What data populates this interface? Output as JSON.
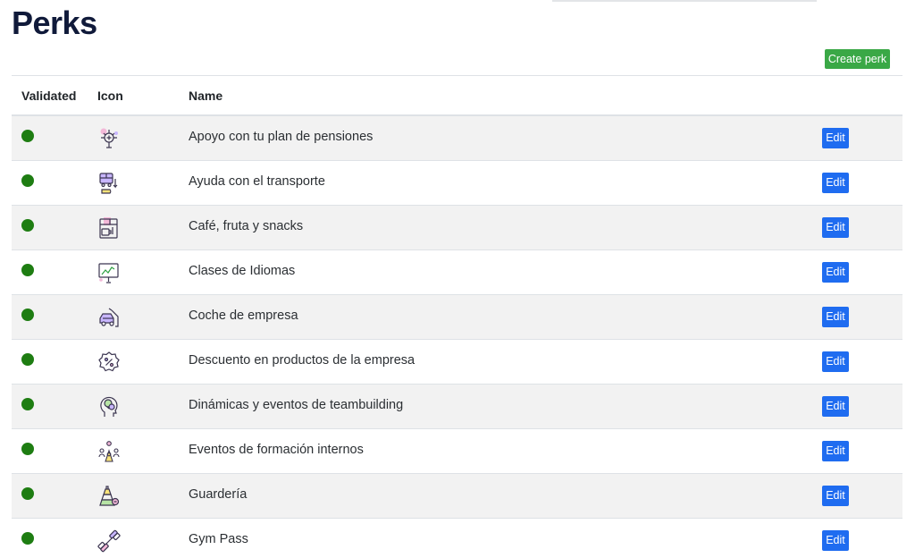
{
  "page": {
    "title": "Perks",
    "create_label": "Create perk"
  },
  "table": {
    "headers": {
      "validated": "Validated",
      "icon": "Icon",
      "name": "Name"
    },
    "rows": [
      {
        "name": "Apoyo con tu plan de pensiones",
        "icon": "pension-chart-icon",
        "validated": true,
        "edit_label": "Edit"
      },
      {
        "name": "Ayuda con el transporte",
        "icon": "transport-bus-icon",
        "validated": true,
        "edit_label": "Edit"
      },
      {
        "name": "Café, fruta y snacks",
        "icon": "coffee-machine-icon",
        "validated": true,
        "edit_label": "Edit"
      },
      {
        "name": "Clases de Idiomas",
        "icon": "presentation-board-icon",
        "validated": true,
        "edit_label": "Edit"
      },
      {
        "name": "Coche de empresa",
        "icon": "company-car-icon",
        "validated": true,
        "edit_label": "Edit"
      },
      {
        "name": "Descuento en productos de la empresa",
        "icon": "discount-badge-icon",
        "validated": true,
        "edit_label": "Edit"
      },
      {
        "name": "Dinámicas y eventos de teambuilding",
        "icon": "teambuilding-head-icon",
        "validated": true,
        "edit_label": "Edit"
      },
      {
        "name": "Eventos de formación internos",
        "icon": "training-group-icon",
        "validated": true,
        "edit_label": "Edit"
      },
      {
        "name": "Guardería",
        "icon": "toy-stacker-icon",
        "validated": true,
        "edit_label": "Edit"
      },
      {
        "name": "Gym Pass",
        "icon": "dumbbell-icon",
        "validated": true,
        "edit_label": "Edit"
      }
    ]
  },
  "colors": {
    "validated_dot": "#1e7d12",
    "create_button": "#3aa846",
    "edit_button": "#1f6cf0",
    "title": "#101a3a",
    "striped_row": "#f2f2f2"
  }
}
